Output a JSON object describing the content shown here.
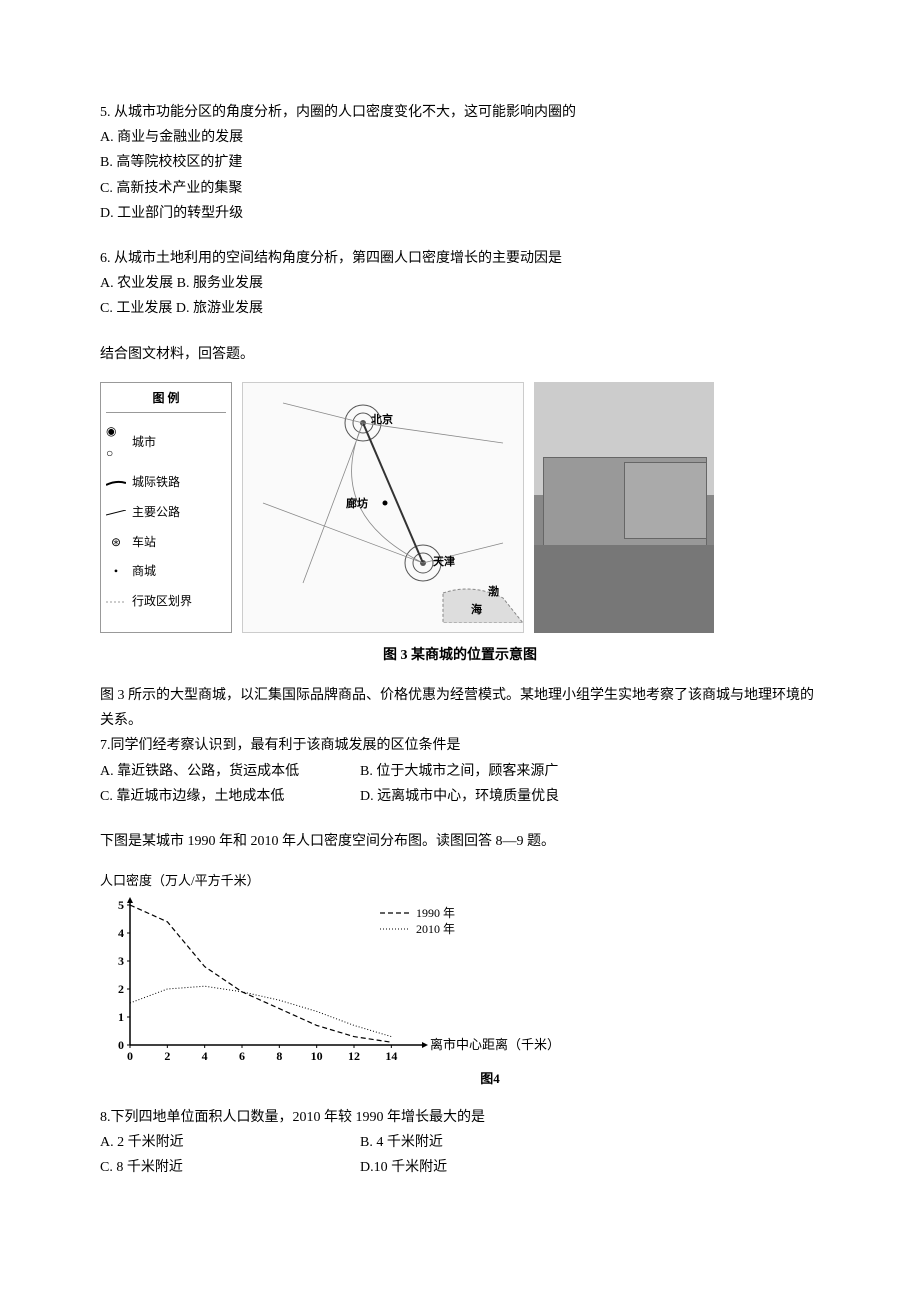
{
  "q5": {
    "text": "5. 从城市功能分区的角度分析，内圈的人口密度变化不大，这可能影响内圈的",
    "A": "A. 商业与金融业的发展",
    "B": "B. 高等院校校区的扩建",
    "C": "C. 高新技术产业的集聚",
    "D": "D. 工业部门的转型升级"
  },
  "q6": {
    "text": "6. 从城市土地利用的空间结构角度分析，第四圈人口密度增长的主要动因是",
    "A": "A. 农业发展",
    "B": "B. 服务业发展",
    "C": "C. 工业发展",
    "D": "D. 旅游业发展"
  },
  "intro1": "结合图文材料，回答题。",
  "figure3": {
    "legend_title": "图 例",
    "legend_city": "城市",
    "legend_rail": "城际铁路",
    "legend_road": "主要公路",
    "legend_station": "车站",
    "legend_mall": "商城",
    "legend_boundary": "行政区划界",
    "map_beijing": "北京",
    "map_langfang": "廊坊",
    "map_tianjin": "天津",
    "map_bohai": "渤",
    "map_hai": "海",
    "caption": "图 3  某商城的位置示意图"
  },
  "desc3": "图 3 所示的大型商城，以汇集国际品牌商品、价格优惠为经营模式。某地理小组学生实地考察了该商城与地理环境的关系。",
  "q7": {
    "text": "7.同学们经考察认识到，最有利于该商城发展的区位条件是",
    "A": "A. 靠近铁路、公路，货运成本低",
    "B": "B. 位于大城市之间，顾客来源广",
    "C": "C. 靠近城市边缘，土地成本低",
    "D": "D. 远离城市中心，环境质量优良"
  },
  "intro2": "下图是某城市 1990 年和 2010 年人口密度空间分布图。读图回答 8—9 题。",
  "chart_data": {
    "type": "line",
    "title": "人口密度（万人/平方千米）",
    "xlabel": "离市中心距离（千米）",
    "ylabel": "",
    "x": [
      0,
      2,
      4,
      6,
      8,
      10,
      12,
      14
    ],
    "xlim": [
      0,
      15
    ],
    "ylim": [
      0,
      5
    ],
    "series": [
      {
        "name": "1990 年",
        "style": "dashed",
        "values": [
          5.0,
          4.4,
          2.8,
          1.9,
          1.3,
          0.7,
          0.3,
          0.1
        ]
      },
      {
        "name": "2010 年",
        "style": "solid-thin",
        "values": [
          1.5,
          2.0,
          2.1,
          1.9,
          1.6,
          1.2,
          0.7,
          0.3
        ]
      }
    ],
    "caption": "图4"
  },
  "q8": {
    "text": "8.下列四地单位面积人口数量，2010 年较 1990 年增长最大的是",
    "A": "A. 2 千米附近",
    "B": "B. 4 千米附近",
    "C": "C. 8 千米附近",
    "D": "D.10 千米附近"
  }
}
